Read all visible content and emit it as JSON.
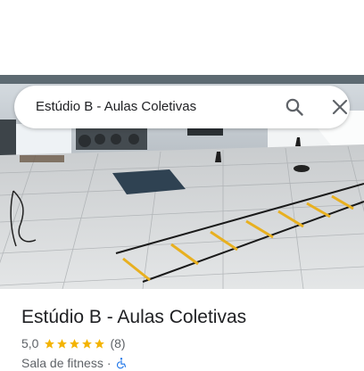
{
  "search": {
    "query": "Estúdio B - Aulas Coletivas",
    "search_icon": "search-icon",
    "close_icon": "close-icon"
  },
  "place": {
    "title": "Estúdio B - Aulas Coletivas",
    "rating": "5,0",
    "stars_filled": 5,
    "stars_total": 5,
    "review_count": "(8)",
    "category": "Sala de fitness",
    "separator": "·",
    "accessibility_icon": "wheelchair-icon"
  },
  "colors": {
    "star": "#f4b400",
    "text_primary": "#202124",
    "text_secondary": "#5f6368",
    "accessibility": "#1a73e8"
  }
}
